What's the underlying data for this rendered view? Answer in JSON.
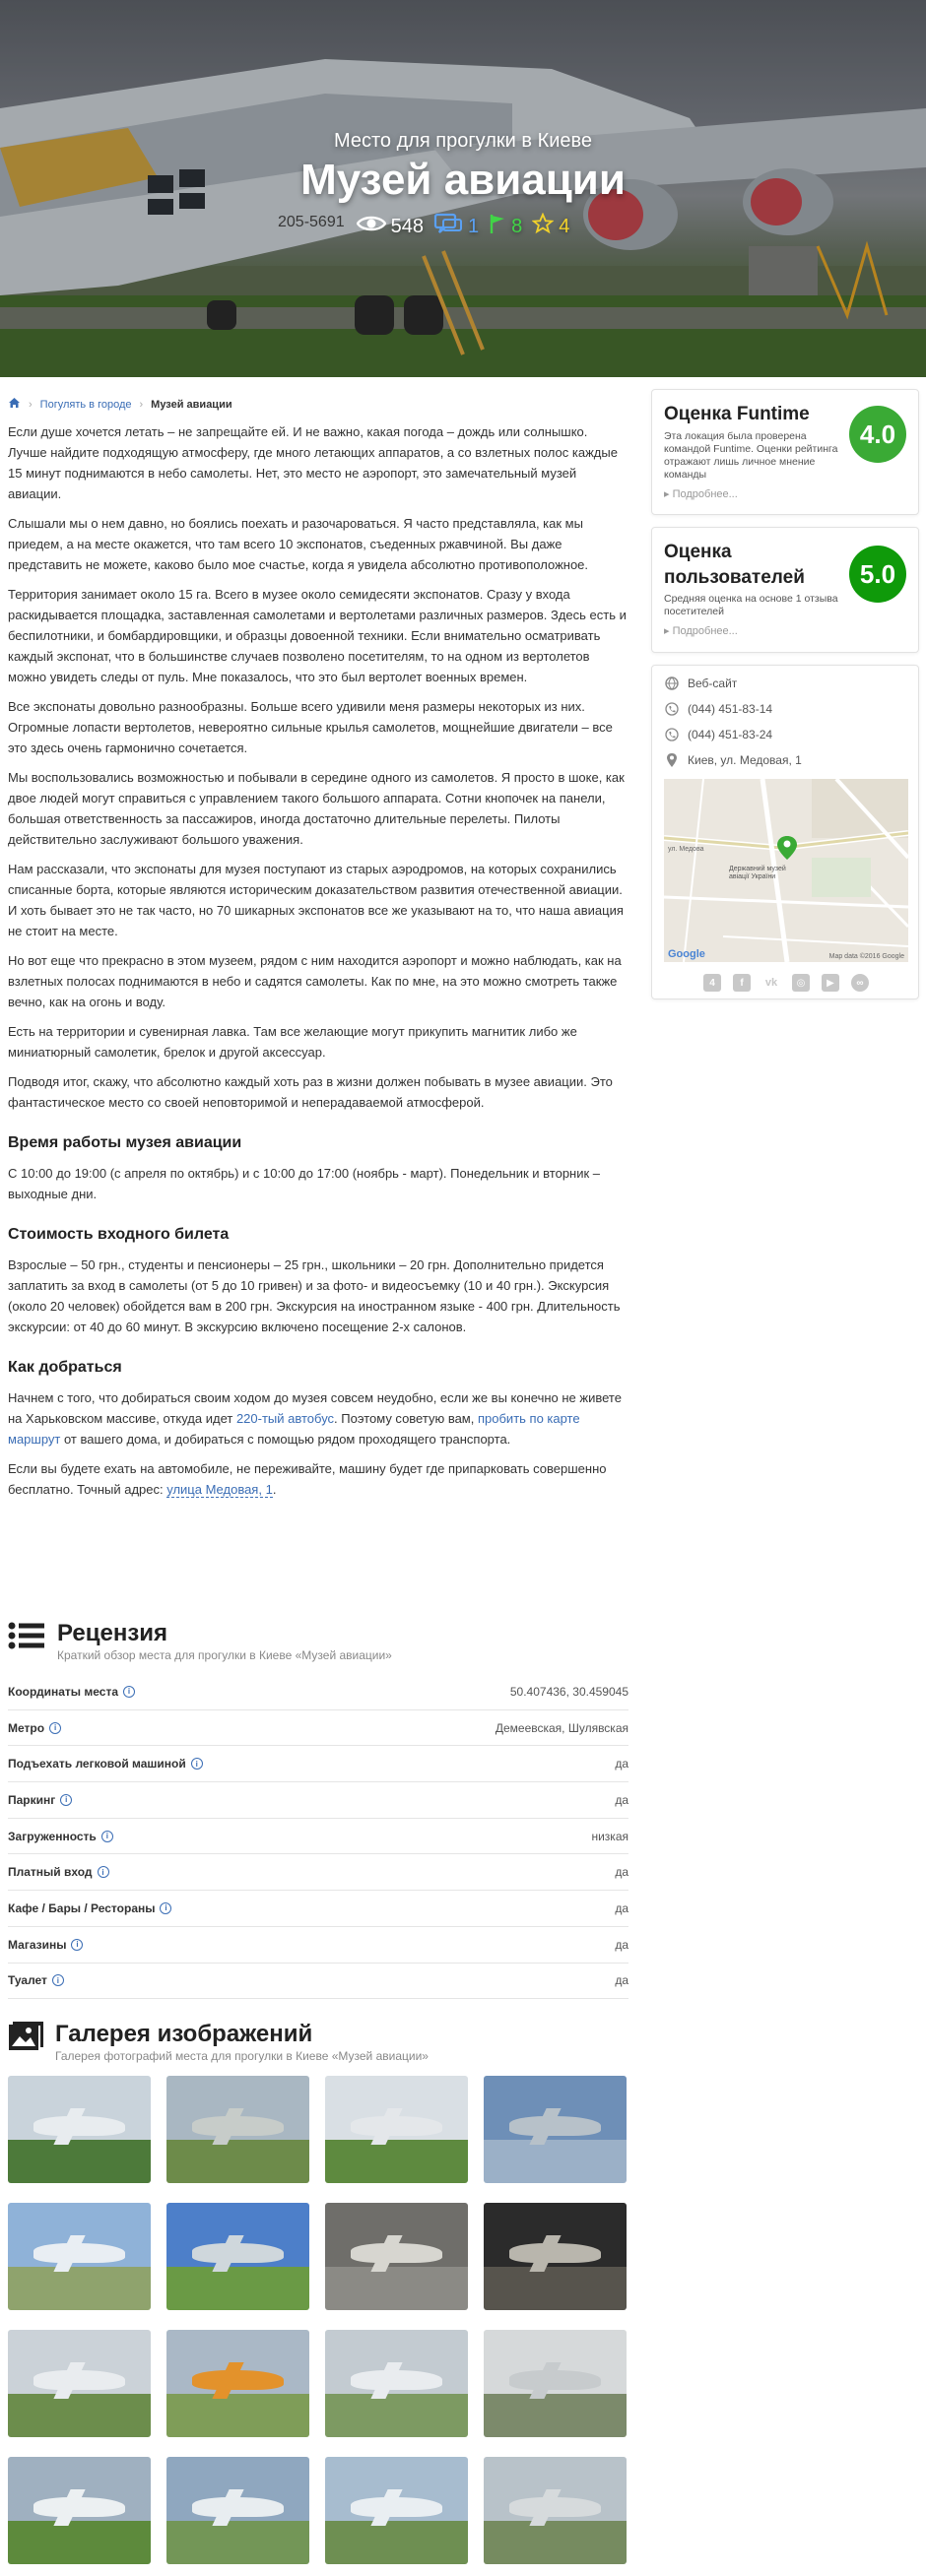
{
  "hero": {
    "subtitle": "Место для прогулки в Киеве",
    "title": "Музей авиации",
    "stats": {
      "views": "548",
      "comments": "1",
      "flags": "8",
      "stars": "4"
    },
    "plane_registration": "205-5691"
  },
  "breadcrumb": {
    "home_icon": "home-icon",
    "parent": "Погулять в городе",
    "current": "Музей авиации"
  },
  "article": {
    "paragraphs_intro": [
      "Если душе хочется летать – не запрещайте ей. И не важно, какая погода – дождь или солнышко. Лучше найдите подходящую атмосферу, где много летающих аппаратов, а со взлетных полос каждые 15 минут поднимаются в небо самолеты. Нет, это место не аэропорт, это замечательный музей авиации.",
      "Слышали мы о нем давно, но боялись поехать и разочароваться. Я часто представляла, как мы приедем, а на месте окажется, что там всего 10 экспонатов, съеденных ржавчиной. Вы даже представить не можете, каково было мое счастье, когда я увидела абсолютно противоположное.",
      "Территория занимает около 15 га. Всего в музее около семидесяти экспонатов. Сразу у входа раскидывается площадка, заставленная самолетами и вертолетами различных размеров. Здесь есть и беспилотники, и бомбардировщики, и образцы довоенной техники. Если внимательно осматривать каждый экспонат, что в большинстве случаев позволено посетителям, то на одном из вертолетов можно увидеть следы от пуль. Мне показалось, что это был вертолет военных времен.",
      "Все экспонаты довольно разнообразны. Больше всего удивили меня размеры некоторых из них. Огромные лопасти вертолетов, невероятно сильные крылья самолетов, мощнейшие двигатели – все это здесь очень гармонично сочетается.",
      "Мы воспользовались возможностью и побывали в середине одного из самолетов. Я просто в шоке, как двое людей могут справиться с управлением такого большого аппарата. Сотни кнопочек на панели, большая ответственность за пассажиров, иногда достаточно длительные перелеты. Пилоты действительно заслуживают большого уважения.",
      "Нам рассказали, что экспонаты для музея поступают из старых аэродромов, на которых сохранились списанные борта, которые являются историческим доказательством развития отечественной авиации. И хоть бывает это не так часто, но 70 шикарных экспонатов все же указывают на то, что наша авиация не стоит на месте.",
      "Но вот еще что прекрасно в этом музеем, рядом с ним находится аэропорт и можно наблюдать, как на взлетных полосах поднимаются в небо и садятся самолеты. Как по мне, на это можно смотреть также вечно, как на огонь и воду.",
      "Есть на территории и сувенирная лавка. Там все желающие могут прикупить магнитик либо же миниатюрный самолетик, брелок и другой аксессуар.",
      "Подводя итог, скажу, что абсолютно каждый хоть раз в жизни должен побывать в музее авиации. Это фантастическое место со своей неповторимой и неперадаваемой атмосферой."
    ],
    "hours_heading": "Время работы музея авиации",
    "hours_text": "С 10:00 до 19:00 (с апреля по октябрь) и с 10:00 до 17:00 (ноябрь - март). Понедельник и вторник – выходные дни.",
    "price_heading": "Стоимость входного билета",
    "price_text": "Взрослые – 50 грн., студенты и пенсионеры – 25 грн., школьники – 20 грн. Дополнительно придется заплатить за вход в самолеты (от 5 до 10 гривен) и за фото- и видеосъемку (10 и 40 грн.). Экскурсия (около 20 человек) обойдется вам в 200 грн. Экскурсия на иностранном языке - 400 грн. Длительность экскурсии: от 40 до 60 минут. В экскурсию включено посещение 2-х салонов.",
    "route_heading": "Как добраться",
    "route_p1_a": "Начнем с того, что добираться своим ходом до музея совсем неудобно, если же вы конечно не живете на Харьковском массиве, откуда идет ",
    "route_p1_link1": "220-тый автобус",
    "route_p1_b": ". Поэтому советую вам, ",
    "route_p1_link2": "пробить по карте маршрут",
    "route_p1_c": " от вашего дома, и добираться с помощью рядом проходящего транспорта.",
    "route_p2_a": "Если вы будете ехать на автомобиле, не переживайте, машину будет где припарковать совершенно бесплатно. Точный адрес: ",
    "route_p2_link": "улица Медовая, 1",
    "route_p2_b": "."
  },
  "sidebar": {
    "funtime": {
      "title": "Оценка Funtime",
      "desc": "Эта локация была проверена командой Funtime. Оценки рейтинга отражают лишь личное мнение команды",
      "more": "Подробнее...",
      "score": "4.0",
      "color": "#3aaa35"
    },
    "users": {
      "title": "Оценка пользователей",
      "desc": "Средняя оценка на основе 1 отзыва посетителей",
      "more": "Подробнее...",
      "score": "5.0",
      "color": "#0f9a0a"
    },
    "contacts": {
      "website": "Веб-сайт",
      "phone1": "(044) 451-83-14",
      "phone2": "(044) 451-83-24",
      "address": "Киев, ул. Медовая, 1"
    },
    "map": {
      "street": "ул. Медова",
      "poi": "Державний музей авіації України",
      "brand": "Google",
      "credit": "Map data ©2016 Google"
    },
    "socials": [
      "foursquare-icon",
      "facebook-icon",
      "vk-icon",
      "instagram-icon",
      "youtube-icon",
      "tripadvisor-icon"
    ]
  },
  "review": {
    "title": "Рецензия",
    "subtitle": "Краткий обзор места для прогулки в Киеве «Музей авиации»",
    "rows": [
      {
        "k": "Координаты места",
        "v": "50.407436, 30.459045"
      },
      {
        "k": "Метро",
        "v": "Демеевская, Шулявская"
      },
      {
        "k": "Подъехать легковой машиной",
        "v": "да"
      },
      {
        "k": "Паркинг",
        "v": "да"
      },
      {
        "k": "Загруженность",
        "v": "низкая"
      },
      {
        "k": "Платный вход",
        "v": "да"
      },
      {
        "k": "Кафе / Бары / Рестораны",
        "v": "да"
      },
      {
        "k": "Магазины",
        "v": "да"
      },
      {
        "k": "Туалет",
        "v": "да"
      }
    ]
  },
  "gallery": {
    "title": "Галерея изображений",
    "subtitle": "Галерея фотографий места для прогулки в Киеве «Музей авиации»"
  }
}
